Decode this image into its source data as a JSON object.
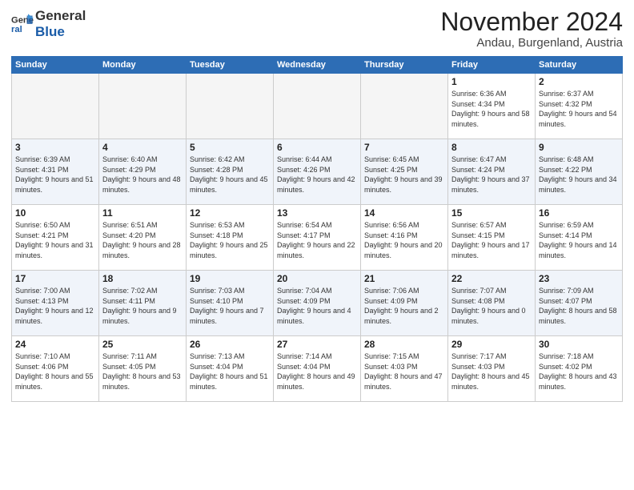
{
  "logo": {
    "text_general": "General",
    "text_blue": "Blue"
  },
  "title": "November 2024",
  "subtitle": "Andau, Burgenland, Austria",
  "days_of_week": [
    "Sunday",
    "Monday",
    "Tuesday",
    "Wednesday",
    "Thursday",
    "Friday",
    "Saturday"
  ],
  "weeks": [
    [
      {
        "day": "",
        "info": "",
        "empty": true
      },
      {
        "day": "",
        "info": "",
        "empty": true
      },
      {
        "day": "",
        "info": "",
        "empty": true
      },
      {
        "day": "",
        "info": "",
        "empty": true
      },
      {
        "day": "",
        "info": "",
        "empty": true
      },
      {
        "day": "1",
        "info": "Sunrise: 6:36 AM\nSunset: 4:34 PM\nDaylight: 9 hours and 58 minutes."
      },
      {
        "day": "2",
        "info": "Sunrise: 6:37 AM\nSunset: 4:32 PM\nDaylight: 9 hours and 54 minutes."
      }
    ],
    [
      {
        "day": "3",
        "info": "Sunrise: 6:39 AM\nSunset: 4:31 PM\nDaylight: 9 hours and 51 minutes."
      },
      {
        "day": "4",
        "info": "Sunrise: 6:40 AM\nSunset: 4:29 PM\nDaylight: 9 hours and 48 minutes."
      },
      {
        "day": "5",
        "info": "Sunrise: 6:42 AM\nSunset: 4:28 PM\nDaylight: 9 hours and 45 minutes."
      },
      {
        "day": "6",
        "info": "Sunrise: 6:44 AM\nSunset: 4:26 PM\nDaylight: 9 hours and 42 minutes."
      },
      {
        "day": "7",
        "info": "Sunrise: 6:45 AM\nSunset: 4:25 PM\nDaylight: 9 hours and 39 minutes."
      },
      {
        "day": "8",
        "info": "Sunrise: 6:47 AM\nSunset: 4:24 PM\nDaylight: 9 hours and 37 minutes."
      },
      {
        "day": "9",
        "info": "Sunrise: 6:48 AM\nSunset: 4:22 PM\nDaylight: 9 hours and 34 minutes."
      }
    ],
    [
      {
        "day": "10",
        "info": "Sunrise: 6:50 AM\nSunset: 4:21 PM\nDaylight: 9 hours and 31 minutes."
      },
      {
        "day": "11",
        "info": "Sunrise: 6:51 AM\nSunset: 4:20 PM\nDaylight: 9 hours and 28 minutes."
      },
      {
        "day": "12",
        "info": "Sunrise: 6:53 AM\nSunset: 4:18 PM\nDaylight: 9 hours and 25 minutes."
      },
      {
        "day": "13",
        "info": "Sunrise: 6:54 AM\nSunset: 4:17 PM\nDaylight: 9 hours and 22 minutes."
      },
      {
        "day": "14",
        "info": "Sunrise: 6:56 AM\nSunset: 4:16 PM\nDaylight: 9 hours and 20 minutes."
      },
      {
        "day": "15",
        "info": "Sunrise: 6:57 AM\nSunset: 4:15 PM\nDaylight: 9 hours and 17 minutes."
      },
      {
        "day": "16",
        "info": "Sunrise: 6:59 AM\nSunset: 4:14 PM\nDaylight: 9 hours and 14 minutes."
      }
    ],
    [
      {
        "day": "17",
        "info": "Sunrise: 7:00 AM\nSunset: 4:13 PM\nDaylight: 9 hours and 12 minutes."
      },
      {
        "day": "18",
        "info": "Sunrise: 7:02 AM\nSunset: 4:11 PM\nDaylight: 9 hours and 9 minutes."
      },
      {
        "day": "19",
        "info": "Sunrise: 7:03 AM\nSunset: 4:10 PM\nDaylight: 9 hours and 7 minutes."
      },
      {
        "day": "20",
        "info": "Sunrise: 7:04 AM\nSunset: 4:09 PM\nDaylight: 9 hours and 4 minutes."
      },
      {
        "day": "21",
        "info": "Sunrise: 7:06 AM\nSunset: 4:09 PM\nDaylight: 9 hours and 2 minutes."
      },
      {
        "day": "22",
        "info": "Sunrise: 7:07 AM\nSunset: 4:08 PM\nDaylight: 9 hours and 0 minutes."
      },
      {
        "day": "23",
        "info": "Sunrise: 7:09 AM\nSunset: 4:07 PM\nDaylight: 8 hours and 58 minutes."
      }
    ],
    [
      {
        "day": "24",
        "info": "Sunrise: 7:10 AM\nSunset: 4:06 PM\nDaylight: 8 hours and 55 minutes."
      },
      {
        "day": "25",
        "info": "Sunrise: 7:11 AM\nSunset: 4:05 PM\nDaylight: 8 hours and 53 minutes."
      },
      {
        "day": "26",
        "info": "Sunrise: 7:13 AM\nSunset: 4:04 PM\nDaylight: 8 hours and 51 minutes."
      },
      {
        "day": "27",
        "info": "Sunrise: 7:14 AM\nSunset: 4:04 PM\nDaylight: 8 hours and 49 minutes."
      },
      {
        "day": "28",
        "info": "Sunrise: 7:15 AM\nSunset: 4:03 PM\nDaylight: 8 hours and 47 minutes."
      },
      {
        "day": "29",
        "info": "Sunrise: 7:17 AM\nSunset: 4:03 PM\nDaylight: 8 hours and 45 minutes."
      },
      {
        "day": "30",
        "info": "Sunrise: 7:18 AM\nSunset: 4:02 PM\nDaylight: 8 hours and 43 minutes."
      }
    ]
  ]
}
